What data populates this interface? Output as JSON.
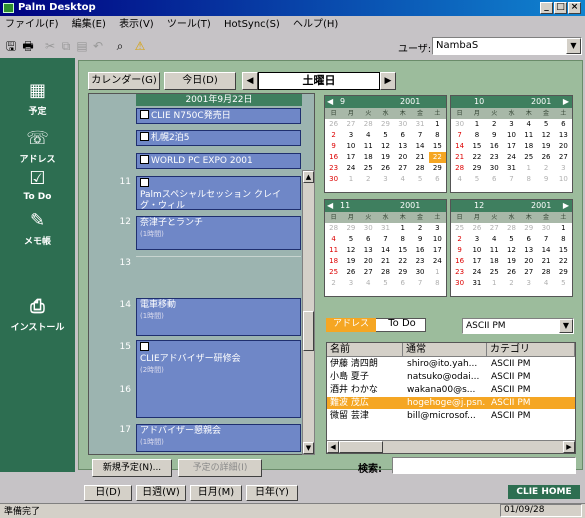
{
  "window": {
    "title": "Palm Desktop"
  },
  "menu": [
    "ファイル(F)",
    "編集(E)",
    "表示(V)",
    "ツール(T)",
    "HotSync(S)",
    "ヘルプ(H)"
  ],
  "toolbar": {
    "user_label": "ユーザ:",
    "user_value": "NambaS"
  },
  "sidebar": [
    {
      "label": "予定",
      "icon": "calendar-icon"
    },
    {
      "label": "アドレス",
      "icon": "phone-icon"
    },
    {
      "label": "To Do",
      "icon": "checklist-icon"
    },
    {
      "label": "メモ帳",
      "icon": "memo-icon"
    },
    {
      "label": "インストール",
      "icon": "install-icon"
    }
  ],
  "calendar": {
    "calendar_btn": "カレンダー(G)",
    "today_btn": "今日(D)",
    "weekday": "土曜日",
    "day_header": "2001年9月22日",
    "hours": [
      "11",
      "12",
      "13",
      "14",
      "15",
      "16",
      "17"
    ],
    "events": [
      {
        "title": "CLIE N750C発売日",
        "sub": ""
      },
      {
        "title": "札幌2泊5",
        "sub": ""
      },
      {
        "title": "WORLD PC EXPO 2001",
        "sub": ""
      },
      {
        "title": "Palmスペシャルセッション クレイグ・ウィル",
        "sub": ""
      },
      {
        "title": "奈津子とランチ",
        "sub": "(1時間)"
      },
      {
        "title": "電車移動",
        "sub": "(1時間)"
      },
      {
        "title": "CLIEアドバイザー研修会",
        "sub": "(2時間)"
      },
      {
        "title": "アドバイザー懇親会",
        "sub": "(1時間)"
      }
    ],
    "new_event_btn": "新規予定(N)...",
    "event_detail_btn": "予定の詳細(I)"
  },
  "months": [
    {
      "month": "9",
      "year": "2001",
      "dow": [
        "日",
        "月",
        "火",
        "水",
        "木",
        "金",
        "土"
      ],
      "days": [
        "26",
        "27",
        "28",
        "29",
        "30",
        "31",
        "1",
        "2",
        "3",
        "4",
        "5",
        "6",
        "7",
        "8",
        "9",
        "10",
        "11",
        "12",
        "13",
        "14",
        "15",
        "16",
        "17",
        "18",
        "19",
        "20",
        "21",
        "22",
        "23",
        "24",
        "25",
        "26",
        "27",
        "28",
        "29",
        "30",
        "1",
        "2",
        "3",
        "4",
        "5",
        "6"
      ],
      "selected": "22"
    },
    {
      "month": "10",
      "year": "2001",
      "dow": [
        "日",
        "月",
        "火",
        "水",
        "木",
        "金",
        "土"
      ],
      "days": [
        "30",
        "1",
        "2",
        "3",
        "4",
        "5",
        "6",
        "7",
        "8",
        "9",
        "10",
        "11",
        "12",
        "13",
        "14",
        "15",
        "16",
        "17",
        "18",
        "19",
        "20",
        "21",
        "22",
        "23",
        "24",
        "25",
        "26",
        "27",
        "28",
        "29",
        "30",
        "31",
        "1",
        "2",
        "3",
        "4",
        "5",
        "6",
        "7",
        "8",
        "9",
        "10"
      ],
      "selected": ""
    },
    {
      "month": "11",
      "year": "2001",
      "dow": [
        "日",
        "月",
        "火",
        "水",
        "木",
        "金",
        "土"
      ],
      "days": [
        "28",
        "29",
        "30",
        "31",
        "1",
        "2",
        "3",
        "4",
        "5",
        "6",
        "7",
        "8",
        "9",
        "10",
        "11",
        "12",
        "13",
        "14",
        "15",
        "16",
        "17",
        "18",
        "19",
        "20",
        "21",
        "22",
        "23",
        "24",
        "25",
        "26",
        "27",
        "28",
        "29",
        "30",
        "1",
        "2",
        "3",
        "4",
        "5",
        "6",
        "7",
        "8"
      ],
      "selected": ""
    },
    {
      "month": "12",
      "year": "2001",
      "dow": [
        "日",
        "月",
        "火",
        "水",
        "木",
        "金",
        "土"
      ],
      "days": [
        "25",
        "26",
        "27",
        "28",
        "29",
        "30",
        "1",
        "2",
        "3",
        "4",
        "5",
        "6",
        "7",
        "8",
        "9",
        "10",
        "11",
        "12",
        "13",
        "14",
        "15",
        "16",
        "17",
        "18",
        "19",
        "20",
        "21",
        "22",
        "23",
        "24",
        "25",
        "26",
        "27",
        "28",
        "29",
        "30",
        "31",
        "1",
        "2",
        "3",
        "4",
        "5"
      ],
      "selected": ""
    }
  ],
  "address": {
    "tab_address": "アドレス",
    "tab_todo": "To Do",
    "category": "ASCII PM",
    "columns": [
      "名前",
      "通常",
      "カテゴリ"
    ],
    "rows": [
      {
        "name": "伊藤 清四朗",
        "contact": "shiro@ito.yah...",
        "category": "ASCII PM"
      },
      {
        "name": "小島 夏子",
        "contact": "natsuko@odai...",
        "category": "ASCII PM"
      },
      {
        "name": "酒井 わかな",
        "contact": "wakana00@s...",
        "category": "ASCII PM"
      },
      {
        "name": "難波 茂広",
        "contact": "hogehoge@j.psn.ne...",
        "category": "ASCII PM"
      },
      {
        "name": "微留 芸津",
        "contact": "bill@microsof...",
        "category": "ASCII PM"
      }
    ],
    "selected_row": 3,
    "search_label": "検索:"
  },
  "view_tabs": [
    "日(D)",
    "日週(W)",
    "日月(M)",
    "日年(Y)"
  ],
  "brand": "CLIE HOME",
  "status": {
    "left": "準備完了",
    "date": "01/09/28"
  },
  "colors": {
    "accent": "#f5a623",
    "sidebar": "#2d6e51",
    "event": "#6f87c7"
  }
}
